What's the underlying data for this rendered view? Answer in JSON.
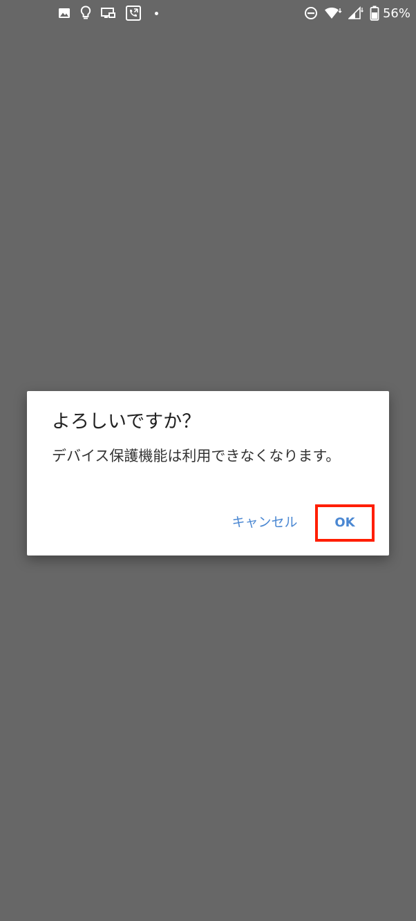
{
  "status_bar": {
    "left_icons": [
      "image-icon",
      "lightbulb-icon",
      "cast-icon",
      "phone-call-icon",
      "dot-icon"
    ],
    "right_icons": [
      "do-not-disturb-icon",
      "wifi-icon",
      "cellular-signal-icon",
      "battery-icon"
    ],
    "battery_percent": "56%"
  },
  "dialog": {
    "title": "よろしいですか？",
    "message": "デバイス保護機能は利用できなくなります。",
    "cancel_label": "キャンセル",
    "ok_label": "OK"
  },
  "colors": {
    "backdrop": "#676767",
    "dialog_bg": "#ffffff",
    "button_text": "#4a87d2",
    "highlight_border": "#ff1e00"
  }
}
